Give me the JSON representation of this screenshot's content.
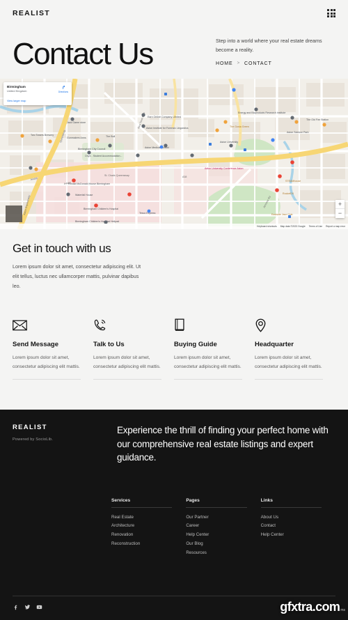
{
  "nav": {
    "brand": "REALIST",
    "menu_icon": "grid-icon"
  },
  "hero": {
    "title": "Contact Us",
    "subtitle": "Step into a world where your real estate dreams become a reality.",
    "breadcrumb": {
      "home": "HOME",
      "separator": ">",
      "current": "CONTACT"
    }
  },
  "map": {
    "card": {
      "place": "Birmingham",
      "country": "United Kingdom",
      "view_larger": "View larger map",
      "directions": "Directions"
    },
    "zoom_in": "+",
    "zoom_out": "−",
    "attribution": {
      "shortcuts": "Keyboard shortcuts",
      "data": "Map data ©2023 Google",
      "terms": "Terms of Use",
      "report": "Report a map error"
    },
    "labels": [
      "Birmingham",
      "Aston University",
      "Aston Medical School",
      "Aston University Main Building",
      "Birmingham City Council",
      "Birmingham Children's Hospital",
      "Ronald McDonald House Birmingham",
      "St. Chads Queensway",
      "Jack Game store",
      "Two Towers Brewery",
      "Gunmakers Arms",
      "The Bull",
      "Tesco Express",
      "The Gosta Green",
      "Eastside Jazz Club",
      "STEAMhouse",
      "RocketDX",
      "The Old Fire Station",
      "Waterfall House",
      "Sacks Of Potatoes",
      "Aston University Conference Aston",
      "Aston Science Park",
      "A4400",
      "A38",
      "A47",
      "Aston Expressway"
    ],
    "colors": {
      "land": "#f2efe9",
      "road_major": "#f7d674",
      "road": "#ffffff",
      "park": "#cfe6c4",
      "water": "#a9d3e8",
      "building": "#e8e2d9",
      "pink_zone": "#f5dada",
      "marker": "#ea4335",
      "marker_gray": "#636a72",
      "marker_amber": "#f0a33c",
      "marker_blue": "#4285f4"
    }
  },
  "touch": {
    "title": "Get in touch with us",
    "body": "Lorem ipsum dolor sit amet, consectetur adipiscing elit. Ut elit tellus, luctus nec ullamcorper mattis, pulvinar dapibus leo."
  },
  "cards": [
    {
      "icon": "envelope-icon",
      "title": "Send Message",
      "body": "Lorem ipsum dolor sit amet, consectetur adipiscing elit mattis."
    },
    {
      "icon": "phone-ring-icon",
      "title": "Talk to Us",
      "body": "Lorem ipsum dolor sit amet, consectetur adipiscing elit mattis."
    },
    {
      "icon": "book-icon",
      "title": "Buying Guide",
      "body": "Lorem ipsum dolor sit amet, consectetur adipiscing elit mattis."
    },
    {
      "icon": "map-pin-icon",
      "title": "Headquarter",
      "body": "Lorem ipsum dolor sit amet, consectetur adipiscing elit mattis."
    }
  ],
  "footer": {
    "brand": "REALIST",
    "powered_by": "Powered by SocioLib.",
    "tagline": "Experience the thrill of finding your perfect home with our comprehensive real estate listings and expert guidance.",
    "columns": [
      {
        "heading": "Services",
        "items": [
          "Real Estate",
          "Architecture",
          "Renovation",
          "Reconstruction"
        ]
      },
      {
        "heading": "Pages",
        "items": [
          "Our Partner",
          "Career",
          "Help Center",
          "Our Blog",
          "Resources"
        ]
      },
      {
        "heading": "Links",
        "items": [
          "About Us",
          "Contact",
          "Help Center"
        ]
      }
    ],
    "socials": [
      "facebook-icon",
      "twitter-icon",
      "youtube-icon"
    ]
  },
  "watermark": {
    "main": "gfxtra.com",
    "sub": "ms"
  }
}
